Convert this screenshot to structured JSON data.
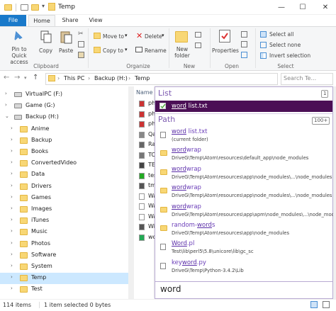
{
  "window": {
    "title": "Temp"
  },
  "ribbon_tabs": [
    "File",
    "Home",
    "Share",
    "View"
  ],
  "ribbon": {
    "pin": "Pin to Quick access",
    "copy": "Copy",
    "paste": "Paste",
    "move_to": "Move to",
    "copy_to": "Copy to",
    "delete": "Delete",
    "rename": "Rename",
    "new_folder": "New folder",
    "properties": "Properties",
    "select_all": "Select all",
    "select_none": "Select none",
    "invert_selection": "Invert selection",
    "groups": {
      "clipboard": "Clipboard",
      "organize": "Organize",
      "new": "New",
      "open": "Open",
      "select": "Select"
    }
  },
  "address": {
    "crumbs": [
      "This PC",
      "Backup (H:)",
      "Temp"
    ],
    "search_placeholder": "Search Te..."
  },
  "tree": {
    "drives": [
      "VirtualPC (F:)",
      "Game (G:)",
      "Backup (H:)"
    ],
    "folders": [
      "Anime",
      "Backup",
      "Books",
      "ConvertedVideo",
      "Data",
      "Drivers",
      "Games",
      "Images",
      "iTunes",
      "Music",
      "Photos",
      "Software",
      "System",
      "Temp",
      "Test"
    ]
  },
  "file_list": {
    "column_header": "Name",
    "items": [
      "ph",
      "ph",
      "ph",
      "Qa",
      "Ra",
      "TC",
      "TE",
      "tes",
      "tm",
      "Wa",
      "Wa",
      "Wa",
      "Wi",
      "wo"
    ]
  },
  "popup": {
    "list_header": "List",
    "list_count": "1",
    "list_item": {
      "name_hl": "word",
      "name_rest": " list.txt"
    },
    "path_header": "Path",
    "path_count": "100+",
    "results": [
      {
        "pre": "",
        "hl": "word",
        "post": " list.txt",
        "path": "(current folder)",
        "icon": "file"
      },
      {
        "pre": "",
        "hl": "word",
        "post": "wrap",
        "path": "DriveG\\Temp\\Atom\\resources\\default_app\\node_modules",
        "icon": "folder"
      },
      {
        "pre": "",
        "hl": "word",
        "post": "wrap",
        "path": "DriveG\\Temp\\Atom\\resources\\app\\node_modules\\...\\node_modules",
        "icon": "folder"
      },
      {
        "pre": "",
        "hl": "word",
        "post": "wrap",
        "path": "DriveG\\Temp\\Atom\\resources\\app\\node_modules\\...\\node_modules",
        "icon": "folder"
      },
      {
        "pre": "",
        "hl": "word",
        "post": "wrap",
        "path": "DriveG\\Temp\\Atom\\resources\\app\\apm\\node_modules\\...\\node_modules",
        "icon": "folder"
      },
      {
        "pre": "random-",
        "hl": "word",
        "post": "s",
        "path": "DriveG\\Temp\\Atom\\resources\\app\\node_modules",
        "icon": "folder"
      },
      {
        "pre": "",
        "hl": "Word",
        "post": ".pl",
        "path": "Test\\lib\\perl5\\5.8\\unicore\\lib\\gc_sc",
        "icon": "file"
      },
      {
        "pre": "key",
        "hl": "word",
        "post": ".py",
        "path": "DriveG\\Temp\\Python-3.4.2\\Lib",
        "icon": "file"
      }
    ],
    "input_value": "word"
  },
  "status": {
    "count": "114 items",
    "selected": "1 item selected  0 bytes"
  },
  "colors": {
    "accent": "#1979ca",
    "popup_accent": "#7c59b0",
    "selected_row": "#4b0f55",
    "tree_selected": "#cce8ff"
  }
}
